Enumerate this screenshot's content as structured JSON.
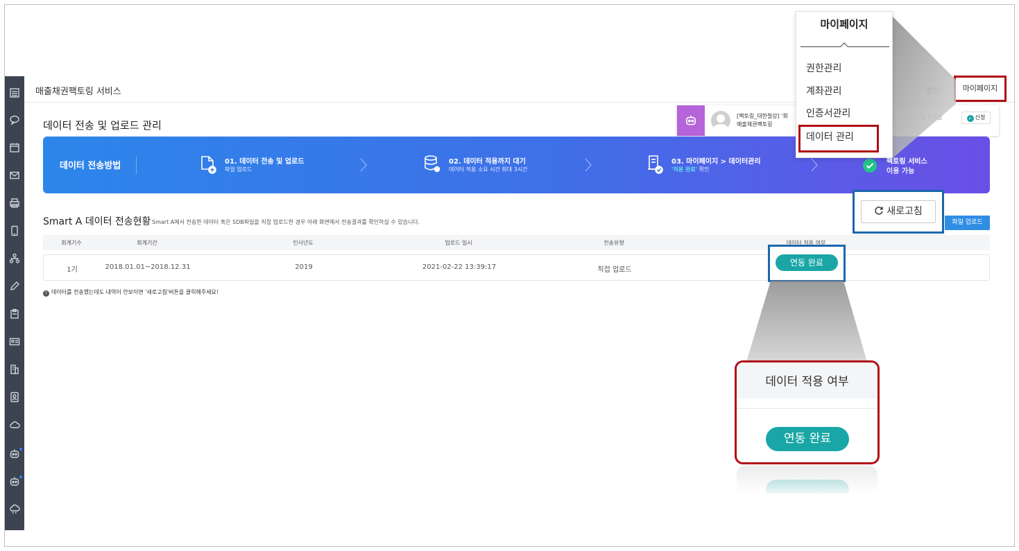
{
  "app": {
    "title": "매출채권팩토링 서비스"
  },
  "topbar": {
    "partial_text": "정산",
    "mypage_label": "마이페이지"
  },
  "toast": {
    "message_line1": "[팩토링_대한철강] '회",
    "message_line2": "매출채권팩토링",
    "time": "4. | 지금",
    "badge": "신청"
  },
  "page": {
    "title": "데이터 전송 및 업로드 관리"
  },
  "banner": {
    "title": "데이터 전송방법",
    "steps": [
      {
        "title": "01. 데이터 전송 및 업로드",
        "sub": "파일 업로드"
      },
      {
        "title": "02. 데이터 적용까지 대기",
        "sub": "데이터 적용 소요 시간 최대 3시간"
      },
      {
        "title": "03. 마이페이지 > 데이터관리",
        "sub_highlight": "'적용 완료'",
        "sub_rest": " 확인"
      },
      {
        "title": "팩토링 서비스",
        "sub": "이용 가능"
      }
    ]
  },
  "section": {
    "title": "Smart A 데이터 전송현황",
    "desc": "Smart A에서 전송한 데이터 혹은 SDB파일을 직접 업로드한 경우 아래 화면에서 전송결과를 확인하실 수 있습니다.",
    "refresh_label": "새로고침",
    "upload_label": "파일 업로드"
  },
  "table": {
    "headers": [
      "회계기수",
      "회계기간",
      "인사년도",
      "업로드 일시",
      "전송유형",
      "데이터 적용 여부"
    ],
    "rows": [
      {
        "period_no": "1기",
        "period": "2018.01.01~2018.12.31",
        "year": "2019",
        "uploaded_at": "2021-02-22 13:39:17",
        "type": "직접 업로드",
        "status": "연동 완료"
      }
    ]
  },
  "note": "데이터를 전송했는데도 내역이 안보이면 '새로고침'버튼을 클릭해주세요!",
  "dropdown": {
    "title": "마이페이지",
    "items": [
      "권한관리",
      "계좌관리",
      "인증서관리",
      "데이터 관리"
    ]
  },
  "zoom": {
    "header": "데이터 적용 여부",
    "status": "연동 완료"
  },
  "colors": {
    "accent": "#2f8de4",
    "status": "#1aa6a6",
    "highlight_red": "#b00d14",
    "highlight_blue": "#1b66ad"
  },
  "icons": {
    "sidebar": [
      "list-icon",
      "chat-icon",
      "calendar-icon",
      "mail-icon",
      "printer-icon",
      "phone-icon",
      "org-icon",
      "pen-icon",
      "clipboard-icon",
      "id-card-icon",
      "building-icon",
      "contacts-icon",
      "cloud-icon",
      "bot-icon",
      "bot-icon",
      "cloud-rain-icon"
    ]
  }
}
